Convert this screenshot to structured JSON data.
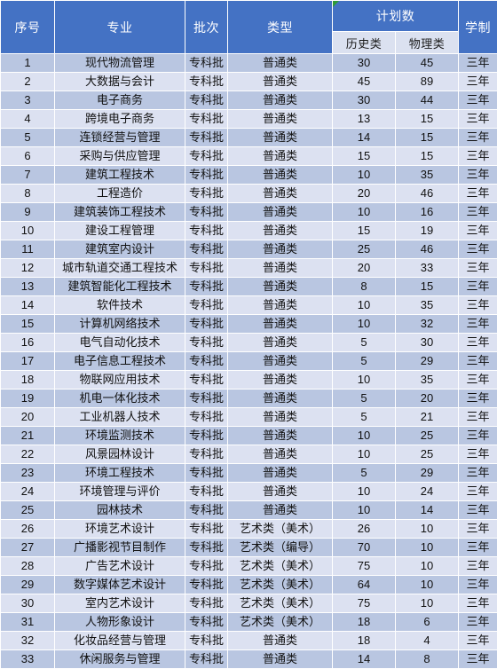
{
  "table": {
    "headers": {
      "index": "序号",
      "major": "专业",
      "batch": "批次",
      "type": "类型",
      "plan_group": "计划数",
      "plan_history": "历史类",
      "plan_physics": "物理类",
      "length": "学制"
    },
    "marker_color": "#2e9b36",
    "header_bg": "#4472c4",
    "row_odd_bg": "#b9c6e1",
    "row_even_bg": "#dce1f1",
    "subheader_bg": "#dbe1f0",
    "rows": [
      {
        "index": "1",
        "major": "现代物流管理",
        "batch": "专科批",
        "type": "普通类",
        "history": "30",
        "physics": "45",
        "length": "三年"
      },
      {
        "index": "2",
        "major": "大数据与会计",
        "batch": "专科批",
        "type": "普通类",
        "history": "45",
        "physics": "89",
        "length": "三年"
      },
      {
        "index": "3",
        "major": "电子商务",
        "batch": "专科批",
        "type": "普通类",
        "history": "30",
        "physics": "44",
        "length": "三年"
      },
      {
        "index": "4",
        "major": "跨境电子商务",
        "batch": "专科批",
        "type": "普通类",
        "history": "13",
        "physics": "15",
        "length": "三年"
      },
      {
        "index": "5",
        "major": "连锁经营与管理",
        "batch": "专科批",
        "type": "普通类",
        "history": "14",
        "physics": "15",
        "length": "三年"
      },
      {
        "index": "6",
        "major": "采购与供应管理",
        "batch": "专科批",
        "type": "普通类",
        "history": "15",
        "physics": "15",
        "length": "三年"
      },
      {
        "index": "7",
        "major": "建筑工程技术",
        "batch": "专科批",
        "type": "普通类",
        "history": "10",
        "physics": "35",
        "length": "三年"
      },
      {
        "index": "8",
        "major": "工程造价",
        "batch": "专科批",
        "type": "普通类",
        "history": "20",
        "physics": "46",
        "length": "三年"
      },
      {
        "index": "9",
        "major": "建筑装饰工程技术",
        "batch": "专科批",
        "type": "普通类",
        "history": "10",
        "physics": "16",
        "length": "三年"
      },
      {
        "index": "10",
        "major": "建设工程管理",
        "batch": "专科批",
        "type": "普通类",
        "history": "15",
        "physics": "19",
        "length": "三年"
      },
      {
        "index": "11",
        "major": "建筑室内设计",
        "batch": "专科批",
        "type": "普通类",
        "history": "25",
        "physics": "46",
        "length": "三年"
      },
      {
        "index": "12",
        "major": "城市轨道交通工程技术",
        "batch": "专科批",
        "type": "普通类",
        "history": "20",
        "physics": "33",
        "length": "三年"
      },
      {
        "index": "13",
        "major": "建筑智能化工程技术",
        "batch": "专科批",
        "type": "普通类",
        "history": "8",
        "physics": "15",
        "length": "三年"
      },
      {
        "index": "14",
        "major": "软件技术",
        "batch": "专科批",
        "type": "普通类",
        "history": "10",
        "physics": "35",
        "length": "三年"
      },
      {
        "index": "15",
        "major": "计算机网络技术",
        "batch": "专科批",
        "type": "普通类",
        "history": "10",
        "physics": "32",
        "length": "三年"
      },
      {
        "index": "16",
        "major": "电气自动化技术",
        "batch": "专科批",
        "type": "普通类",
        "history": "5",
        "physics": "30",
        "length": "三年"
      },
      {
        "index": "17",
        "major": "电子信息工程技术",
        "batch": "专科批",
        "type": "普通类",
        "history": "5",
        "physics": "29",
        "length": "三年"
      },
      {
        "index": "18",
        "major": "物联网应用技术",
        "batch": "专科批",
        "type": "普通类",
        "history": "10",
        "physics": "35",
        "length": "三年"
      },
      {
        "index": "19",
        "major": "机电一体化技术",
        "batch": "专科批",
        "type": "普通类",
        "history": "5",
        "physics": "20",
        "length": "三年"
      },
      {
        "index": "20",
        "major": "工业机器人技术",
        "batch": "专科批",
        "type": "普通类",
        "history": "5",
        "physics": "21",
        "length": "三年"
      },
      {
        "index": "21",
        "major": "环境监测技术",
        "batch": "专科批",
        "type": "普通类",
        "history": "10",
        "physics": "25",
        "length": "三年"
      },
      {
        "index": "22",
        "major": "风景园林设计",
        "batch": "专科批",
        "type": "普通类",
        "history": "10",
        "physics": "25",
        "length": "三年"
      },
      {
        "index": "23",
        "major": "环境工程技术",
        "batch": "专科批",
        "type": "普通类",
        "history": "5",
        "physics": "29",
        "length": "三年"
      },
      {
        "index": "24",
        "major": "环境管理与评价",
        "batch": "专科批",
        "type": "普通类",
        "history": "10",
        "physics": "24",
        "length": "三年"
      },
      {
        "index": "25",
        "major": "园林技术",
        "batch": "专科批",
        "type": "普通类",
        "history": "10",
        "physics": "14",
        "length": "三年"
      },
      {
        "index": "26",
        "major": "环境艺术设计",
        "batch": "专科批",
        "type": "艺术类（美术）",
        "history": "26",
        "physics": "10",
        "length": "三年"
      },
      {
        "index": "27",
        "major": "广播影视节目制作",
        "batch": "专科批",
        "type": "艺术类（编导）",
        "history": "70",
        "physics": "10",
        "length": "三年"
      },
      {
        "index": "28",
        "major": "广告艺术设计",
        "batch": "专科批",
        "type": "艺术类（美术）",
        "history": "75",
        "physics": "10",
        "length": "三年"
      },
      {
        "index": "29",
        "major": "数字媒体艺术设计",
        "batch": "专科批",
        "type": "艺术类（美术）",
        "history": "64",
        "physics": "10",
        "length": "三年"
      },
      {
        "index": "30",
        "major": "室内艺术设计",
        "batch": "专科批",
        "type": "艺术类（美术）",
        "history": "75",
        "physics": "10",
        "length": "三年"
      },
      {
        "index": "31",
        "major": "人物形象设计",
        "batch": "专科批",
        "type": "艺术类（美术）",
        "history": "18",
        "physics": "6",
        "length": "三年"
      },
      {
        "index": "32",
        "major": "化妆品经营与管理",
        "batch": "专科批",
        "type": "普通类",
        "history": "18",
        "physics": "4",
        "length": "三年"
      },
      {
        "index": "33",
        "major": "休闲服务与管理",
        "batch": "专科批",
        "type": "普通类",
        "history": "14",
        "physics": "8",
        "length": "三年"
      }
    ]
  }
}
